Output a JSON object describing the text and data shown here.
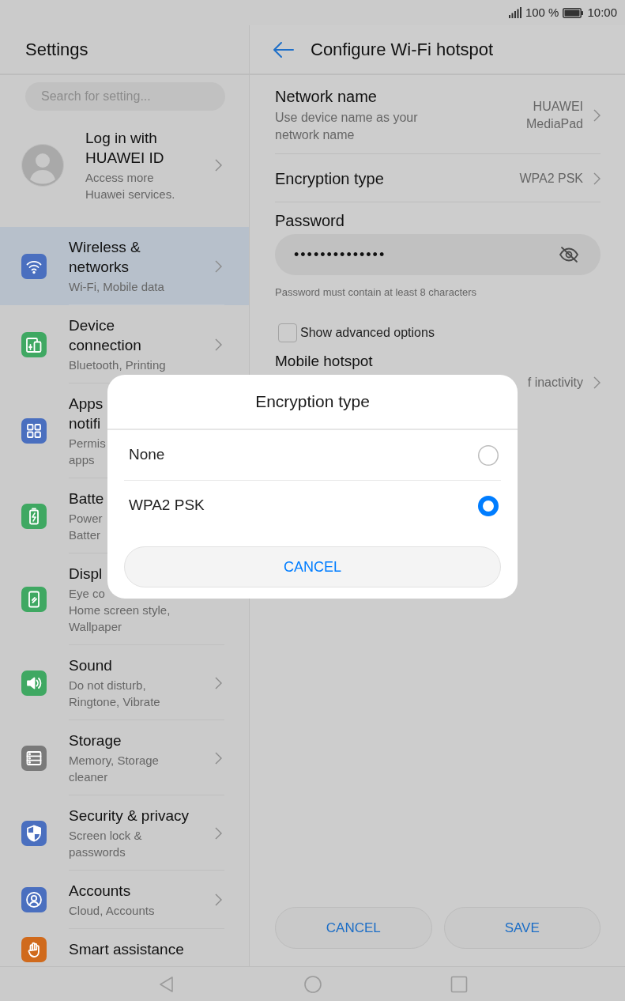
{
  "status_bar": {
    "battery": "100 %",
    "time": "10:00"
  },
  "sidebar": {
    "title": "Settings",
    "search": {
      "placeholder": "Search for setting..."
    },
    "account": {
      "title": "Log in with\nHUAWEI ID",
      "subtitle": "Access more\nHuawei services."
    },
    "items": [
      {
        "title": "Wireless &\nnetworks",
        "subtitle": "Wi-Fi, Mobile data",
        "color": "#4a6fbf",
        "selected": true,
        "chevron": true
      },
      {
        "title": "Device\nconnection",
        "subtitle": "Bluetooth, Printing",
        "color": "#3fa862",
        "selected": false,
        "chevron": true
      },
      {
        "title": "Apps\nnotifi",
        "subtitle": "Permis\napps",
        "color": "#4a6fbf",
        "selected": false,
        "chevron": false
      },
      {
        "title": "Batte",
        "subtitle": "Power\nBatter",
        "color": "#3fa862",
        "selected": false,
        "chevron": false
      },
      {
        "title": "Displ",
        "subtitle": "Eye co\nHome screen style,\nWallpaper",
        "color": "#3fa862",
        "selected": false,
        "chevron": false
      },
      {
        "title": "Sound",
        "subtitle": "Do not disturb,\nRingtone, Vibrate",
        "color": "#3fa862",
        "selected": false,
        "chevron": true
      },
      {
        "title": "Storage",
        "subtitle": "Memory, Storage\ncleaner",
        "color": "#7a7a7a",
        "selected": false,
        "chevron": true
      },
      {
        "title": "Security & privacy",
        "subtitle": "Screen lock &\npasswords",
        "color": "#4a6fbf",
        "selected": false,
        "chevron": true
      },
      {
        "title": "Accounts",
        "subtitle": "Cloud, Accounts",
        "color": "#4a6fbf",
        "selected": false,
        "chevron": true
      },
      {
        "title": "Smart assistance",
        "color": "#d06a1c",
        "selected": false,
        "chevron": false
      }
    ]
  },
  "page": {
    "title": "Configure Wi-Fi hotspot",
    "rows": [
      {
        "kind": "link",
        "title": "Network name",
        "subtitle": "Use device name as your\nnetwork name",
        "value": "HUAWEI\nMediaPad"
      },
      {
        "kind": "link",
        "title": "Encryption type",
        "value": "WPA2 PSK"
      },
      {
        "kind": "password",
        "label": "Password",
        "value": "••••••••••••••",
        "hint": "Password must contain at least 8 characters"
      },
      {
        "kind": "checkbox",
        "label": "Show advanced options",
        "checked": false
      },
      {
        "kind": "covered",
        "title": "Mobile hotspot",
        "value": "f inactivity"
      }
    ],
    "buttons": [
      {
        "label": "CANCEL"
      },
      {
        "label": "SAVE"
      }
    ]
  },
  "dialog": {
    "title": "Encryption type",
    "options": [
      {
        "label": "None",
        "selected": false
      },
      {
        "label": "WPA2 PSK",
        "selected": true
      }
    ],
    "cancel": "CANCEL"
  }
}
